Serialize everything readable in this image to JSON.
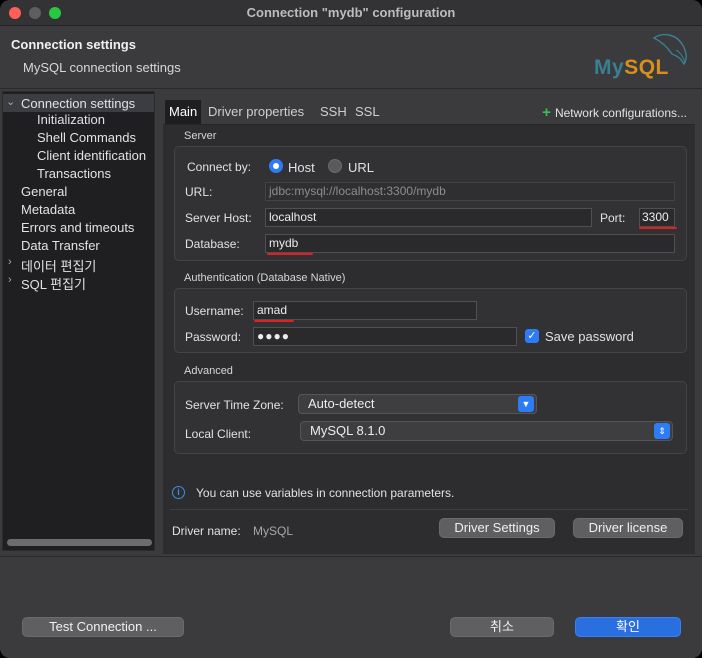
{
  "window": {
    "title": "Connection \"mydb\" configuration"
  },
  "header": {
    "title": "Connection settings",
    "subtitle": "MySQL connection settings",
    "logo_part1": "My",
    "logo_part2": "SQL"
  },
  "sidebar": {
    "items": [
      {
        "label": "Connection settings"
      },
      {
        "label": "Initialization"
      },
      {
        "label": "Shell Commands"
      },
      {
        "label": "Client identification"
      },
      {
        "label": "Transactions"
      },
      {
        "label": "General"
      },
      {
        "label": "Metadata"
      },
      {
        "label": "Errors and timeouts"
      },
      {
        "label": "Data Transfer"
      },
      {
        "label": "데이터 편집기"
      },
      {
        "label": "SQL 편집기"
      }
    ]
  },
  "tabs": {
    "items": [
      {
        "label": "Main"
      },
      {
        "label": "Driver properties"
      },
      {
        "label": "SSH"
      },
      {
        "label": "SSL"
      }
    ],
    "network_config": "Network configurations..."
  },
  "server": {
    "group": "Server",
    "connect_by_label": "Connect by:",
    "host_option": "Host",
    "url_option": "URL",
    "url_label": "URL:",
    "url_value": "jdbc:mysql://localhost:3300/mydb",
    "host_label": "Server Host:",
    "host_value": "localhost",
    "port_label": "Port:",
    "port_value": "3300",
    "database_label": "Database:",
    "database_value": "mydb"
  },
  "auth": {
    "group": "Authentication (Database Native)",
    "username_label": "Username:",
    "username_value": "amad",
    "password_label": "Password:",
    "password_value": "●●●●",
    "save_password_label": "Save password"
  },
  "advanced": {
    "group": "Advanced",
    "timezone_label": "Server Time Zone:",
    "timezone_value": "Auto-detect",
    "client_label": "Local Client:",
    "client_value": "MySQL 8.1.0"
  },
  "info": {
    "text": "You can use variables in connection parameters."
  },
  "driver": {
    "name_label": "Driver name:",
    "name_value": "MySQL",
    "settings_button": "Driver Settings",
    "license_button": "Driver license"
  },
  "footer": {
    "test_button": "Test Connection ...",
    "cancel_button": "취소",
    "ok_button": "확인"
  },
  "colors": {
    "accent": "#2d7cf6",
    "annotation_red": "#e02020"
  }
}
